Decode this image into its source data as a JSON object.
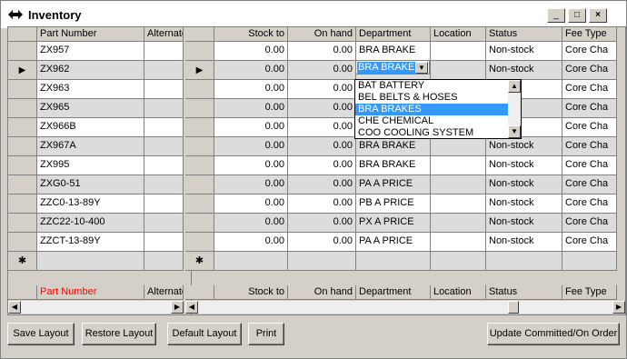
{
  "window": {
    "title": "Inventory",
    "minimize": "_",
    "maximize": "□",
    "close": "×"
  },
  "columns": {
    "left": [
      "Part Number",
      "Alternate"
    ],
    "right": [
      "Stock to",
      "On hand",
      "Department",
      "Location",
      "Status",
      "Fee Type"
    ]
  },
  "rows": [
    {
      "part": "ZX957",
      "stock": "0.00",
      "onhand": "0.00",
      "dept": "BRA BRAKE",
      "loc": "",
      "status": "Non-stock",
      "fee": "Core Cha"
    },
    {
      "part": "ZX962",
      "stock": "0.00",
      "onhand": "0.00",
      "dept": "BRA BRAKE",
      "loc": "",
      "status": "Non-stock",
      "fee": "Core Cha"
    },
    {
      "part": "ZX963",
      "stock": "0.00",
      "onhand": "0.00",
      "dept": "",
      "loc": "",
      "status": "ock",
      "fee": "Core Cha"
    },
    {
      "part": "ZX965",
      "stock": "0.00",
      "onhand": "0.00",
      "dept": "",
      "loc": "",
      "status": "ock",
      "fee": "Core Cha"
    },
    {
      "part": "ZX966B",
      "stock": "0.00",
      "onhand": "0.00",
      "dept": "",
      "loc": "",
      "status": "ock",
      "fee": "Core Cha"
    },
    {
      "part": "ZX967A",
      "stock": "0.00",
      "onhand": "0.00",
      "dept": "BRA BRAKE",
      "loc": "",
      "status": "Non-stock",
      "fee": "Core Cha"
    },
    {
      "part": "ZX995",
      "stock": "0.00",
      "onhand": "0.00",
      "dept": "BRA BRAKE",
      "loc": "",
      "status": "Non-stock",
      "fee": "Core Cha"
    },
    {
      "part": "ZXG0-51",
      "stock": "0.00",
      "onhand": "0.00",
      "dept": "PA A PRICE",
      "loc": "",
      "status": "Non-stock",
      "fee": "Core Cha"
    },
    {
      "part": "ZZC0-13-89Y",
      "stock": "0.00",
      "onhand": "0.00",
      "dept": "PB A PRICE",
      "loc": "",
      "status": "Non-stock",
      "fee": "Core Cha"
    },
    {
      "part": "ZZC22-10-400",
      "stock": "0.00",
      "onhand": "0.00",
      "dept": "PX A PRICE",
      "loc": "",
      "status": "Non-stock",
      "fee": "Core Cha"
    },
    {
      "part": "ZZCT-13-89Y",
      "stock": "0.00",
      "onhand": "0.00",
      "dept": "PA A PRICE",
      "loc": "",
      "status": "Non-stock",
      "fee": "Core Cha"
    }
  ],
  "new_row_marker": "✱",
  "current_row_marker": "▶",
  "combo": {
    "value": "BRA BRAKE",
    "arrow": "▼"
  },
  "dropdown": {
    "items": [
      "BAT BATTERY",
      "BEL BELTS & HOSES",
      "BRA BRAKES",
      "CHE CHEMICAL",
      "COO COOLING SYSTEM"
    ],
    "selected_index": 2
  },
  "footer": {
    "left": [
      "Part Number",
      "Alternate"
    ],
    "right": [
      "Stock to",
      "On hand",
      "Department",
      "Location",
      "Status",
      "Fee Type"
    ],
    "part_number_color": "#ff0000"
  },
  "buttons": {
    "save": "Save Layout",
    "restore": "Restore Layout",
    "default": "Default Layout",
    "print": "Print",
    "update": "Update Committed/On Order"
  }
}
